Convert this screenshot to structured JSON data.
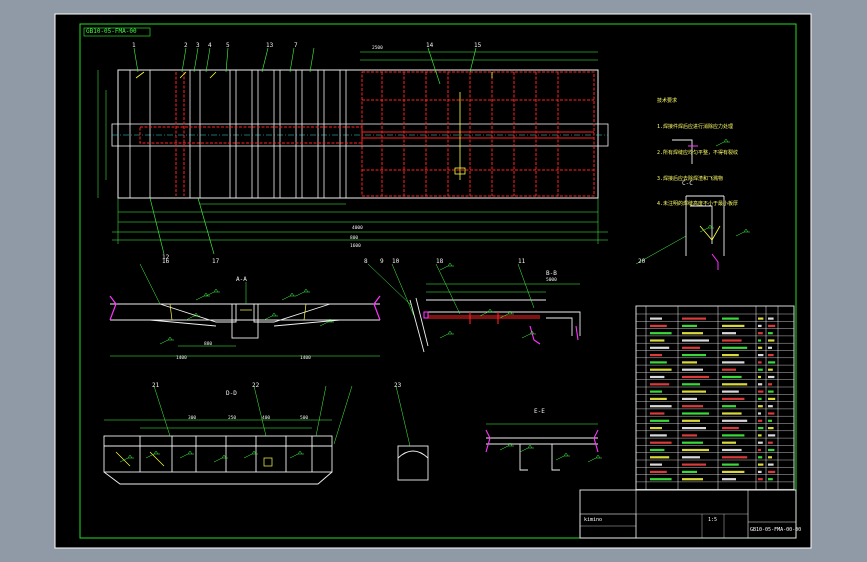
{
  "drawing": {
    "code_top_left": "GB10-05-FMA-00",
    "code_bottom_right": "GB10-05-FMA-00-00",
    "designer": "kimino",
    "scale": "1:5"
  },
  "balloons": [
    "1",
    "2",
    "3",
    "4",
    "5",
    "7",
    "8",
    "9",
    "10",
    "11",
    "12",
    "13",
    "14",
    "15",
    "16",
    "17",
    "18",
    "20",
    "21",
    "22",
    "23"
  ],
  "section_labels": [
    "A-A",
    "B-B",
    "C-C",
    "D-D",
    "E-E"
  ],
  "dimensions": [
    "1400",
    "880",
    "1400",
    "4000",
    "2500",
    "5000",
    "300",
    "250",
    "400",
    "500",
    "800",
    "1600"
  ],
  "notes_title": "技术要求",
  "notes": [
    "1.焊接件焊后应进行消除应力处理",
    "2.所有焊缝应均匀平整，不得有裂纹",
    "3.焊接后应去除焊渣和飞溅物",
    "4.未注明的焊缝高度不小于最小板厚"
  ],
  "colors": {
    "frame": "#22dd22",
    "red": "#ff2222",
    "yellow": "#ffff44",
    "white": "#f0f0f0",
    "magenta": "#ff33ff",
    "cyan": "#33dddd"
  }
}
